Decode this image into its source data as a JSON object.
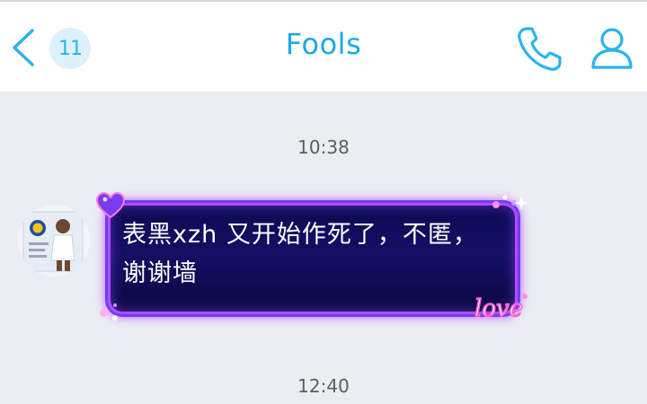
{
  "header": {
    "title": "Fools",
    "unread_count": "11"
  },
  "messages": [
    {
      "timestamp": "10:38",
      "text": "表黑xzh 又开始作死了，不匿，谢谢墙",
      "decoration": "love"
    }
  ],
  "next_timestamp": "12:40",
  "icons": {
    "back": "back-arrow-icon",
    "call": "phone-icon",
    "profile": "profile-icon"
  },
  "colors": {
    "accent": "#1da7e8",
    "badge_bg": "#dcf1fb",
    "background": "#ebedf2",
    "bubble_bg": "#100c5c",
    "bubble_glow": "#b14cff"
  }
}
